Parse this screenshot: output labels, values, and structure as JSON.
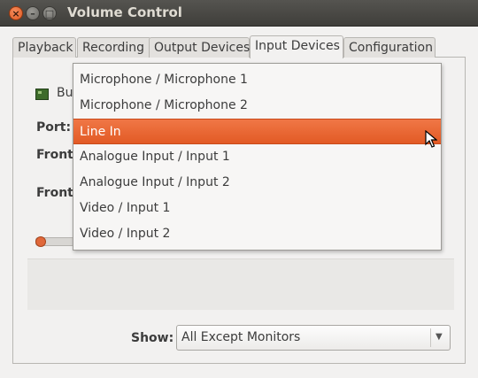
{
  "window": {
    "title": "Volume Control",
    "close_glyph": "×",
    "min_glyph": "–",
    "max_glyph": "□"
  },
  "tabs": [
    {
      "label": "Playback"
    },
    {
      "label": "Recording"
    },
    {
      "label": "Output Devices"
    },
    {
      "label": "Input Devices",
      "active": true
    },
    {
      "label": "Configuration"
    }
  ],
  "device": {
    "name_partial": "Bu",
    "port_label": "Port:",
    "front_label_1": "Front",
    "front_label_2": "Front"
  },
  "port_dropdown": {
    "options": [
      {
        "label": "Microphone / Microphone 1"
      },
      {
        "label": "Microphone / Microphone 2"
      },
      {
        "label": "Line In",
        "selected": true
      },
      {
        "label": "Analogue Input / Input 1"
      },
      {
        "label": "Analogue Input / Input 2"
      },
      {
        "label": "Video / Input 1"
      },
      {
        "label": "Video / Input 2"
      }
    ]
  },
  "show": {
    "label": "Show:",
    "value": "All Except Monitors",
    "arrow_glyph": "▼"
  },
  "colors": {
    "accent": "#e25a25",
    "titlebar": "#3f3e3a"
  }
}
